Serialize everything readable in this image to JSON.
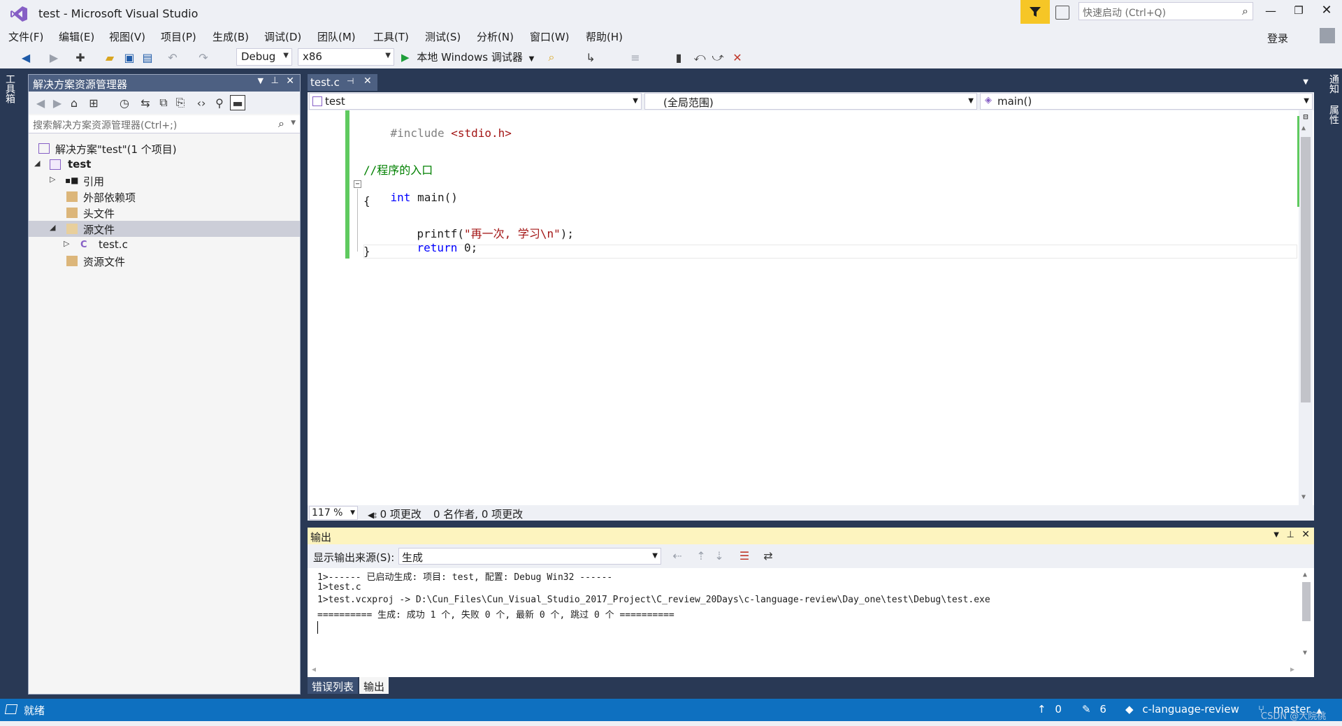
{
  "window": {
    "title": "test - Microsoft Visual Studio",
    "quick_launch_placeholder": "快速启动 (Ctrl+Q)",
    "signin": "登录"
  },
  "menu": [
    "文件(F)",
    "编辑(E)",
    "视图(V)",
    "项目(P)",
    "生成(B)",
    "调试(D)",
    "团队(M)",
    "工具(T)",
    "测试(S)",
    "分析(N)",
    "窗口(W)",
    "帮助(H)"
  ],
  "toolbar": {
    "config": "Debug",
    "platform": "x86",
    "run_label": "本地 Windows 调试器"
  },
  "side_tabs": {
    "left": "工具箱",
    "right_top": "通知",
    "right_bottom": "属性"
  },
  "solution_explorer": {
    "title": "解决方案资源管理器",
    "search_placeholder": "搜索解决方案资源管理器(Ctrl+;)",
    "items": [
      {
        "label": "解决方案\"test\"(1 个项目)"
      },
      {
        "label": "test"
      },
      {
        "label": "引用"
      },
      {
        "label": "外部依赖项"
      },
      {
        "label": "头文件"
      },
      {
        "label": "源文件"
      },
      {
        "label": "test.c"
      },
      {
        "label": "资源文件"
      }
    ]
  },
  "editor": {
    "tab": "test.c",
    "nav_project": "test",
    "nav_scope": "(全局范围)",
    "nav_member": "main()",
    "code": {
      "line1_prefix": "#include ",
      "line1_header": "<stdio.h>",
      "line2": "//程序的入口",
      "line3_kw": "int",
      "line3_rest": " main()",
      "line4": "{",
      "line5_fn": "printf(",
      "line5_str": "\"再一次, 学习\\n\"",
      "line5_end": ");",
      "line6_kw": "return",
      "line6_rest": " 0;",
      "line7": "}"
    },
    "zoom": "117 %",
    "changes": "0 项更改",
    "authors": "0 名作者, 0 项更改"
  },
  "output": {
    "title": "输出",
    "source_label": "显示输出来源(S):",
    "source_value": "生成",
    "lines": [
      "1>------ 已启动生成: 项目: test, 配置: Debug Win32 ------",
      "1>test.c",
      "1>test.vcxproj -> D:\\Cun_Files\\Cun_Visual_Studio_2017_Project\\C_review_20Days\\c-language-review\\Day_one\\test\\Debug\\test.exe",
      "========== 生成: 成功 1 个, 失败 0 个, 最新 0 个, 跳过 0 个 =========="
    ]
  },
  "bottom_tabs": [
    "错误列表",
    "输出"
  ],
  "status": {
    "ready": "就绪",
    "push_count": "0",
    "edit_count": "6",
    "repo": "c-language-review",
    "branch": "master",
    "watermark": "CSDN @大院桃"
  },
  "colors": {
    "accent": "#0e70c0",
    "panel_header": "#4d6082",
    "background": "#293955",
    "change_bar": "#5fca5f"
  }
}
